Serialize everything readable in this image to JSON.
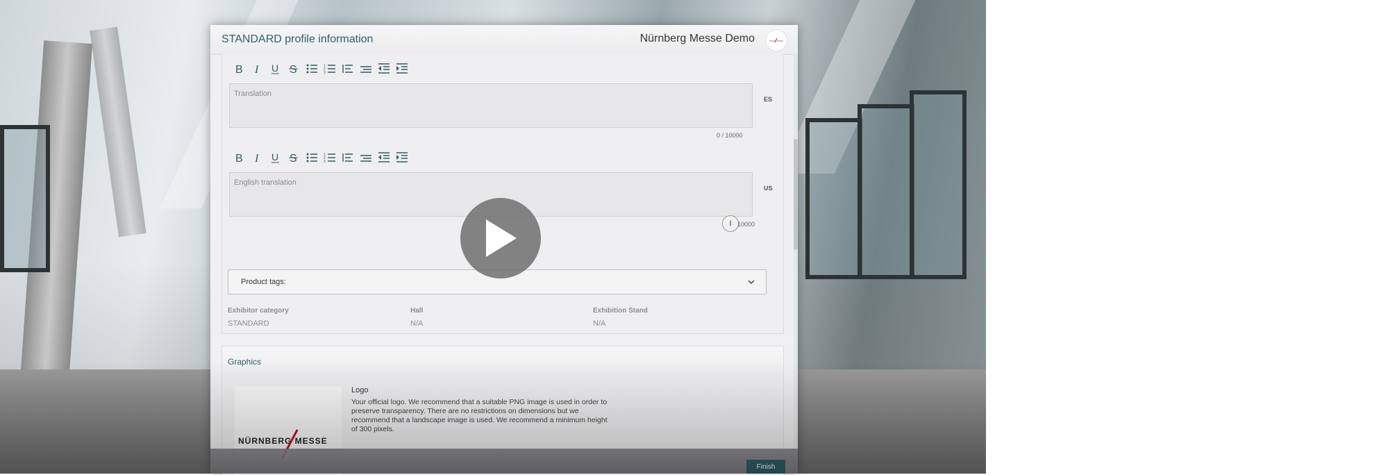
{
  "modal": {
    "title": "STANDARD profile information",
    "organization": "Nürnberg Messe Demo"
  },
  "editors": [
    {
      "placeholder": "Translation",
      "lang": "ES",
      "counter": "0 / 10000"
    },
    {
      "placeholder": "English translation",
      "lang": "US",
      "counter": "10000"
    }
  ],
  "toolbar_icons": [
    "bold-icon",
    "italic-icon",
    "underline-icon",
    "strikethrough-icon",
    "bullet-list-icon",
    "numbered-list-icon",
    "align-left-icon",
    "align-justify-icon",
    "outdent-icon",
    "indent-icon"
  ],
  "product_tags": {
    "label": "Product tags:"
  },
  "info": [
    {
      "label": "Exhibitor category",
      "value": "STANDARD"
    },
    {
      "label": "Hall",
      "value": "N/A"
    },
    {
      "label": "Exhibition Stand",
      "value": "N/A"
    }
  ],
  "graphics": {
    "title": "Graphics",
    "logo_label": "Logo",
    "logo_text": "NÜRNBERG MESSE",
    "logo_description": "Your official logo. We recommend that a suitable PNG image is used in order to preserve transparency. There are no restrictions on dimensions but we recommend that a landscape image is used. We recommend a minimum height of 300 pixels."
  },
  "footer": {
    "finish_label": "Finish"
  },
  "colors": {
    "accent": "#2f5d67",
    "logo_red": "#c0121c"
  }
}
